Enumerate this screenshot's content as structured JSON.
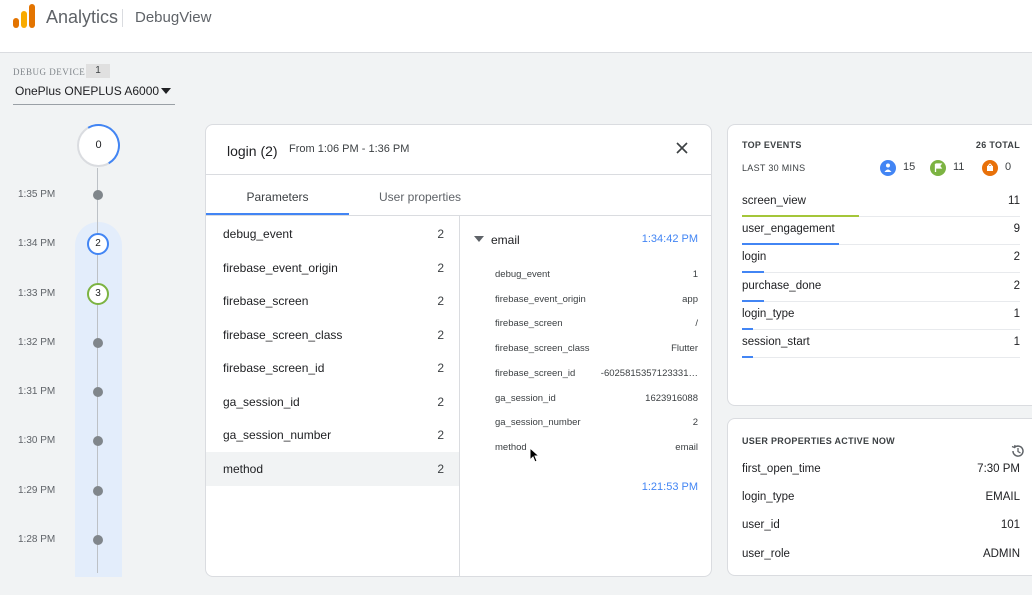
{
  "header": {
    "app_title": "Analytics",
    "page_title": "DebugView"
  },
  "debug_device": {
    "label": "DEBUG DEVICE",
    "count": "1",
    "selected": "OnePlus ONEPLUS A6000"
  },
  "timeline": {
    "top_count": "0",
    "times": [
      "1:35 PM",
      "1:34 PM",
      "1:33 PM",
      "1:32 PM",
      "1:31 PM",
      "1:30 PM",
      "1:29 PM",
      "1:28 PM"
    ],
    "bubbles": [
      {
        "value": "2",
        "color": "#4285f4"
      },
      {
        "value": "3",
        "color": "#7cb342"
      }
    ]
  },
  "event_panel": {
    "title": "login (2)",
    "range": "From 1:06 PM - 1:36 PM",
    "tabs": [
      "Parameters",
      "User properties"
    ],
    "parameters": [
      {
        "name": "debug_event",
        "count": "2"
      },
      {
        "name": "firebase_event_origin",
        "count": "2"
      },
      {
        "name": "firebase_screen",
        "count": "2"
      },
      {
        "name": "firebase_screen_class",
        "count": "2"
      },
      {
        "name": "firebase_screen_id",
        "count": "2"
      },
      {
        "name": "ga_session_id",
        "count": "2"
      },
      {
        "name": "ga_session_number",
        "count": "2"
      },
      {
        "name": "method",
        "count": "2"
      }
    ],
    "detail": {
      "name": "email",
      "time": "1:34:42 PM",
      "items": [
        {
          "key": "debug_event",
          "value": "1"
        },
        {
          "key": "firebase_event_origin",
          "value": "app"
        },
        {
          "key": "firebase_screen",
          "value": "/"
        },
        {
          "key": "firebase_screen_class",
          "value": "Flutter"
        },
        {
          "key": "firebase_screen_id",
          "value": "-6025815357123331…"
        },
        {
          "key": "ga_session_id",
          "value": "1623916088"
        },
        {
          "key": "ga_session_number",
          "value": "2"
        },
        {
          "key": "method",
          "value": "email"
        }
      ],
      "next_time": "1:21:53 PM"
    }
  },
  "top_events": {
    "title": "TOP EVENTS",
    "total": "26 TOTAL",
    "subtitle": "LAST 30 MINS",
    "stats": [
      {
        "icon": "person-icon",
        "value": "15",
        "color": "#4285f4"
      },
      {
        "icon": "flag-icon",
        "value": "11",
        "color": "#7cb342"
      },
      {
        "icon": "error-icon",
        "value": "0",
        "color": "#e8710a"
      }
    ],
    "events": [
      {
        "name": "screen_view",
        "count": "11",
        "fraction": 0.42,
        "color": "#a4c639"
      },
      {
        "name": "user_engagement",
        "count": "9",
        "fraction": 0.35,
        "color": "#4285f4"
      },
      {
        "name": "login",
        "count": "2",
        "fraction": 0.08,
        "color": "#4285f4"
      },
      {
        "name": "purchase_done",
        "count": "2",
        "fraction": 0.08,
        "color": "#4285f4"
      },
      {
        "name": "login_type",
        "count": "1",
        "fraction": 0.04,
        "color": "#4285f4"
      },
      {
        "name": "session_start",
        "count": "1",
        "fraction": 0.04,
        "color": "#4285f4"
      }
    ]
  },
  "user_properties": {
    "title": "USER PROPERTIES ACTIVE NOW",
    "items": [
      {
        "key": "first_open_time",
        "value": "7:30 PM"
      },
      {
        "key": "login_type",
        "value": "EMAIL"
      },
      {
        "key": "user_id",
        "value": "101"
      },
      {
        "key": "user_role",
        "value": "ADMIN"
      }
    ]
  }
}
